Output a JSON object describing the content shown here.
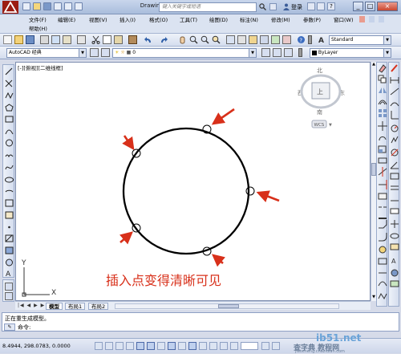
{
  "title_bar": {
    "document_title": "Drawing1.dwg",
    "search_placeholder": "键入关键字或短语",
    "login_label": "登录",
    "help_label": "?",
    "minimize": "_",
    "restore": "□",
    "close": "×"
  },
  "menu": {
    "items": [
      "文件(F)",
      "编辑(E)",
      "视图(V)",
      "插入(I)",
      "格式(O)",
      "工具(T)",
      "绘图(D)",
      "标注(N)",
      "修改(M)",
      "参数(P)",
      "窗口(W)"
    ],
    "help": "帮助(H)"
  },
  "toolbar": {
    "text_style": "Standard",
    "workspace": "AutoCAD 经典",
    "layer": "0",
    "color": "ByLayer"
  },
  "viewport": {
    "label": "[-][俯视][二维线框]",
    "viewcube": {
      "north": "北",
      "south": "南",
      "east": "东",
      "west": "西",
      "face": "上",
      "wcs": "WCS"
    },
    "annotation": "插入点变得清晰可见",
    "ucs_y": "Y",
    "ucs_x": "X"
  },
  "layout_tabs": [
    "模型",
    "布局1",
    "布局2"
  ],
  "command_line": {
    "history": "正在重生成模型。",
    "prompt": "命令:"
  },
  "status_bar": {
    "coordinates": "8.4944,  298.0783, 0.0000",
    "watermark_1": "ib51.net",
    "watermark_2": "查字典 教程网",
    "watermark_3": "jiaocheng.chazidian.com"
  },
  "colors": {
    "accent_red": "#d8301a",
    "circle": "#000000",
    "canvas_bg": "#ffffff"
  }
}
